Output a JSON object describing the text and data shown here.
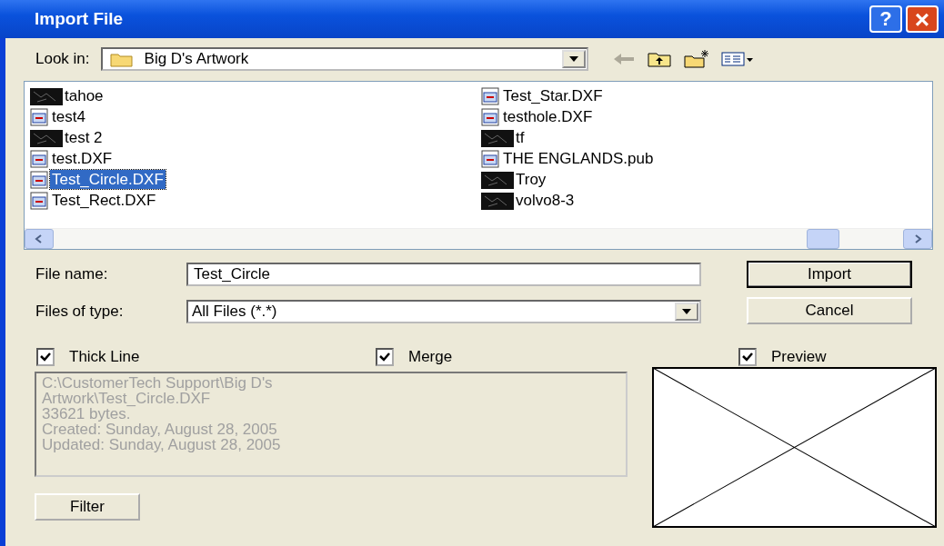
{
  "window": {
    "title": "Import File",
    "buttons": [
      "?",
      "×"
    ]
  },
  "look_in": {
    "label": "Look in:",
    "value": "Big D's Artwork"
  },
  "files": [
    {
      "name": "tahoe",
      "kind": "image",
      "selected": false
    },
    {
      "name": "test4",
      "kind": "document",
      "selected": false
    },
    {
      "name": "test 2",
      "kind": "image",
      "selected": false
    },
    {
      "name": "test.DXF",
      "kind": "document",
      "selected": false
    },
    {
      "name": "Test_Circle.DXF",
      "kind": "document",
      "selected": true
    },
    {
      "name": "Test_Rect.DXF",
      "kind": "document",
      "selected": false
    },
    {
      "name": "Test_Star.DXF",
      "kind": "document",
      "selected": false
    },
    {
      "name": "testhole.DXF",
      "kind": "document",
      "selected": false
    },
    {
      "name": "tf",
      "kind": "image",
      "selected": false
    },
    {
      "name": "THE ENGLANDS.pub",
      "kind": "document",
      "selected": false
    },
    {
      "name": "Troy",
      "kind": "image",
      "selected": false
    },
    {
      "name": "volvo8-3",
      "kind": "image",
      "selected": false
    }
  ],
  "file_name": {
    "label": "File name:",
    "value": "Test_Circle"
  },
  "file_type": {
    "label": "Files of type:",
    "value": "All Files (*.*)"
  },
  "buttons": {
    "import": "Import",
    "cancel": "Cancel",
    "filter": "Filter"
  },
  "options": [
    {
      "label": "Thick Line",
      "checked": true
    },
    {
      "label": "Merge",
      "checked": true
    },
    {
      "label": "Preview",
      "checked": true
    }
  ],
  "info": [
    "C:\\CustomerTech Support\\Big D's",
    "Artwork\\Test_Circle.DXF",
    "33621 bytes.",
    "Created: Sunday, August 28, 2005",
    "Updated: Sunday, August 28, 2005"
  ]
}
